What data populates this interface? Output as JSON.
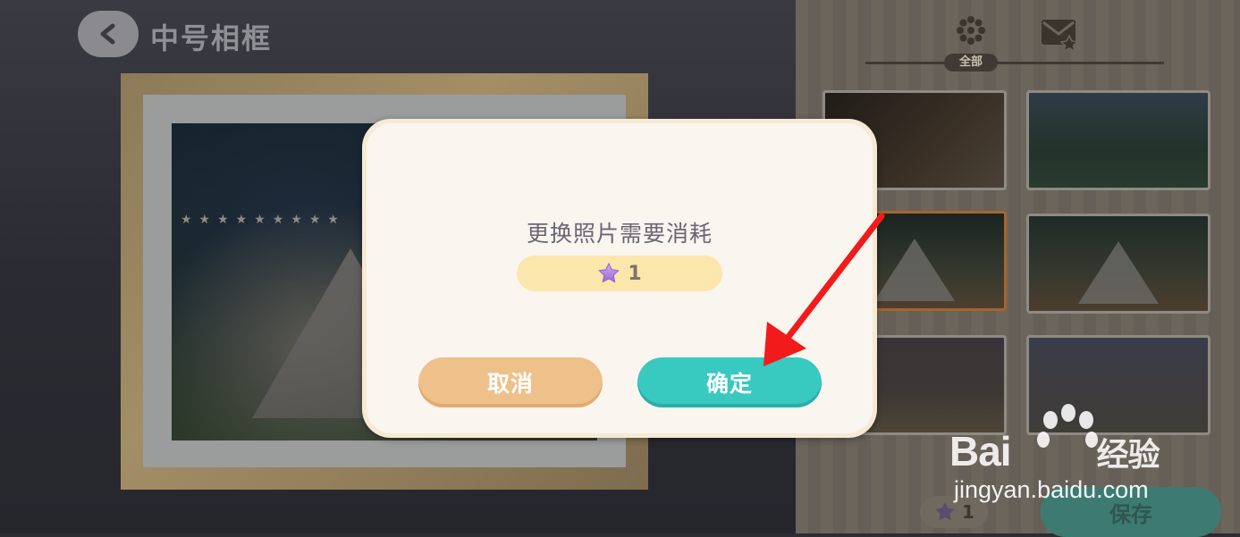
{
  "header": {
    "title": "中号相框"
  },
  "right_panel": {
    "tabs": [
      {
        "label": "全部"
      }
    ],
    "cost": {
      "value": "1"
    },
    "save_label": "保存"
  },
  "dialog": {
    "message": "更换照片需要消耗",
    "cost_value": "1",
    "cancel_label": "取消",
    "confirm_label": "确定"
  },
  "colors": {
    "confirm": "#38c9c0",
    "cancel": "#eec08a",
    "cost_badge": "#fbe6ab",
    "annotation_arrow": "#f21b1b"
  },
  "icons": [
    "back-arrow-icon",
    "filter-icon",
    "mail-star-icon",
    "star-icon",
    "annotation-arrow"
  ],
  "watermark": {
    "brand": "Bai",
    "brand_suffix": "经验",
    "url": "jingyan.baidu.com"
  }
}
